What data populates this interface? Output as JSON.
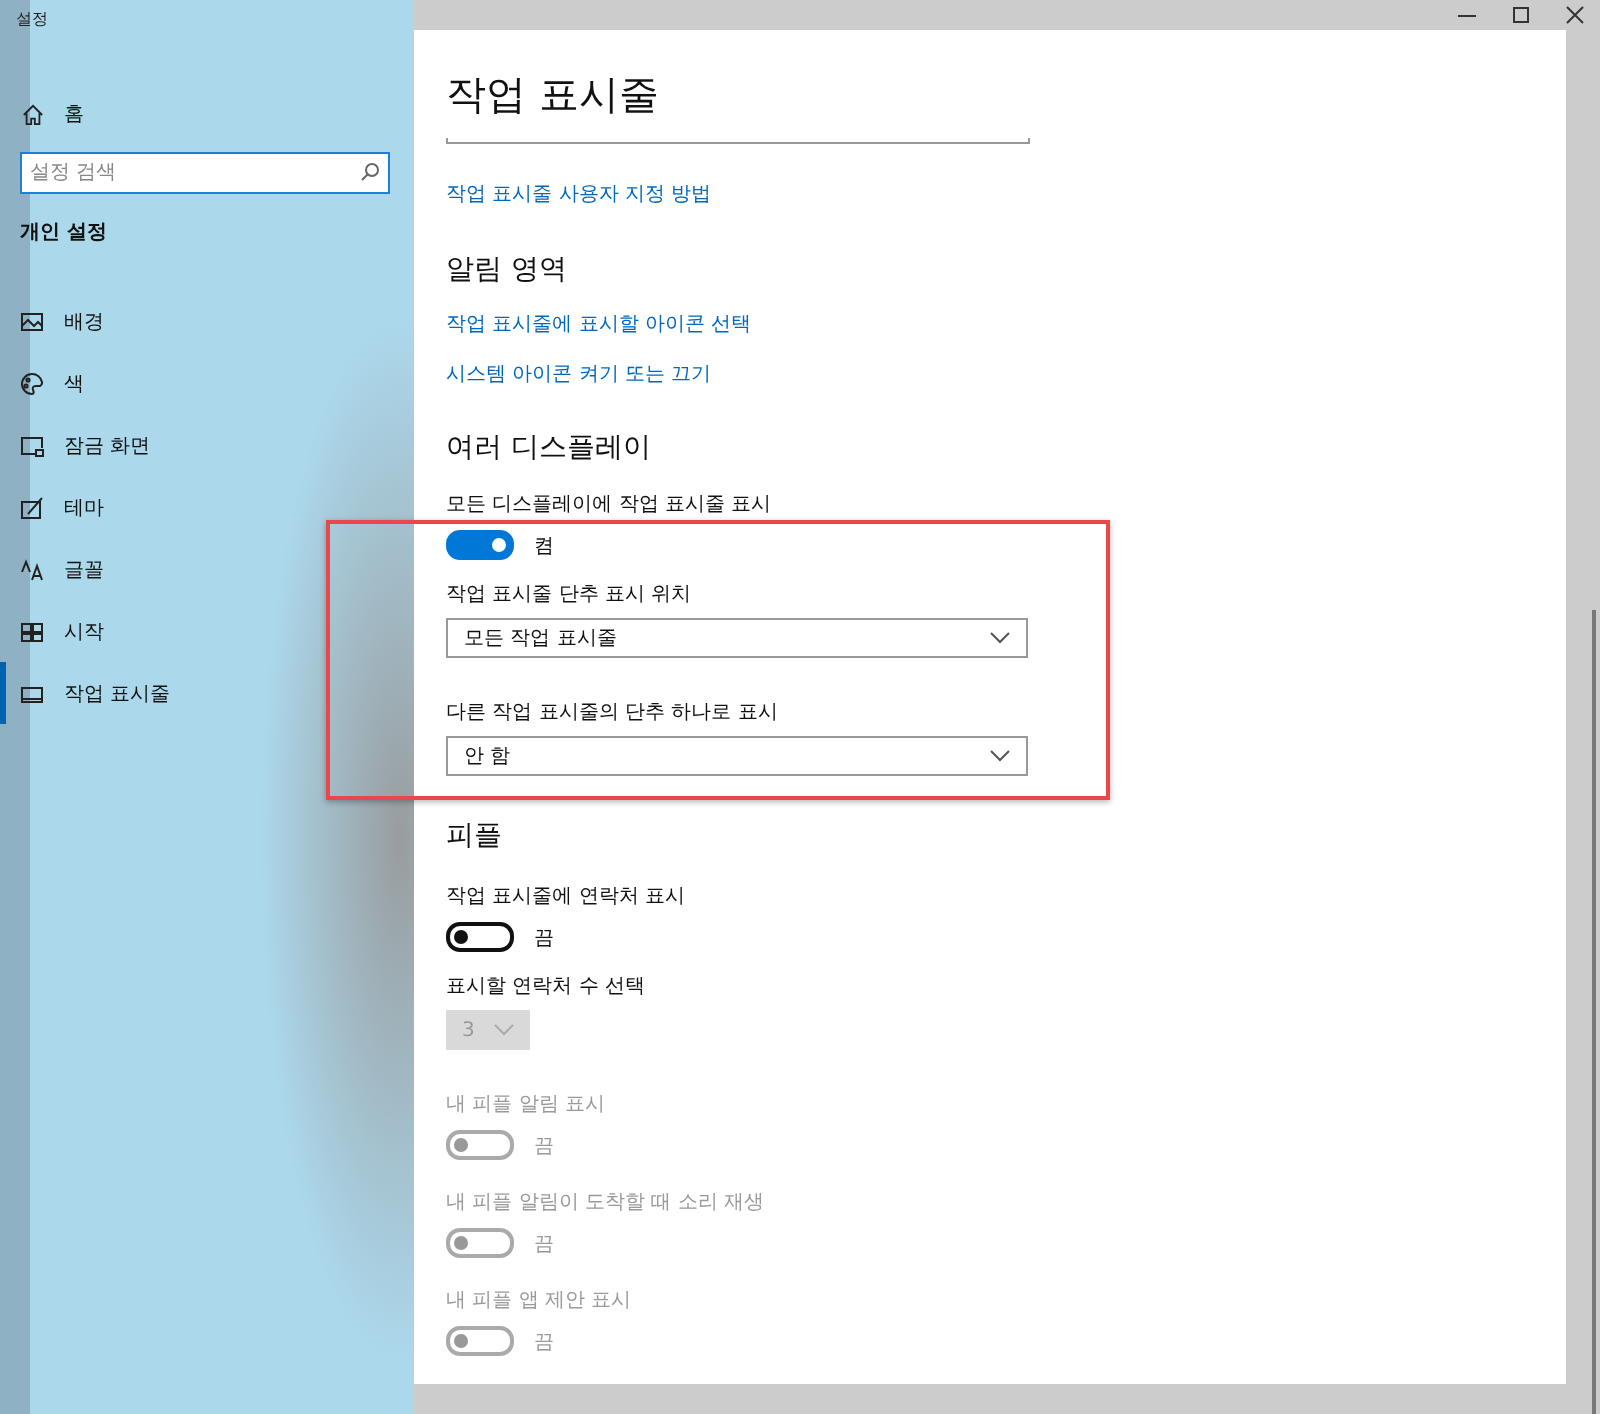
{
  "window": {
    "title": "설정"
  },
  "sidebar": {
    "home": "홈",
    "search": {
      "placeholder": "설정 검색"
    },
    "section": "개인 설정",
    "items": [
      {
        "label": "배경",
        "selected": false
      },
      {
        "label": "색",
        "selected": false
      },
      {
        "label": "잠금 화면",
        "selected": false
      },
      {
        "label": "테마",
        "selected": false
      },
      {
        "label": "글꼴",
        "selected": false
      },
      {
        "label": "시작",
        "selected": false
      },
      {
        "label": "작업 표시줄",
        "selected": true
      }
    ]
  },
  "page": {
    "title": "작업 표시줄",
    "blocks": [
      {
        "kind": "link",
        "text": "작업 표시줄 사용자 지정 방법"
      },
      {
        "kind": "heading",
        "text": "알림 영역"
      },
      {
        "kind": "link",
        "text": "작업 표시줄에 표시할 아이콘 선택"
      },
      {
        "kind": "link",
        "text": "시스템 아이콘 켜기 또는 끄기"
      },
      {
        "kind": "heading",
        "text": "여러 디스플레이"
      },
      {
        "kind": "toggle",
        "label": "모든 디스플레이에 작업 표시줄 표시",
        "on": true,
        "state_text": "켬",
        "disabled": false
      },
      {
        "kind": "dropdown",
        "label": "작업 표시줄 단추 표시 위치",
        "value": "모든 작업 표시줄",
        "disabled": false
      },
      {
        "kind": "dropdown",
        "label": "다른 작업 표시줄의 단추 하나로 표시",
        "value": "안 함",
        "disabled": false
      },
      {
        "kind": "heading",
        "text": "피플"
      },
      {
        "kind": "toggle",
        "label": "작업 표시줄에 연락처 표시",
        "on": false,
        "state_text": "끔",
        "disabled": false
      },
      {
        "kind": "dropdown",
        "label": "표시할 연락처 수 선택",
        "value": "3",
        "disabled": true
      },
      {
        "kind": "toggle",
        "label": "내 피플 알림 표시",
        "on": false,
        "state_text": "끔",
        "disabled": true
      },
      {
        "kind": "toggle",
        "label": "내 피플 알림이 도착할 때 소리 재생",
        "on": false,
        "state_text": "끔",
        "disabled": true
      },
      {
        "kind": "toggle",
        "label": "내 피플 앱 제안 표시",
        "on": false,
        "state_text": "끔",
        "disabled": true
      }
    ]
  }
}
